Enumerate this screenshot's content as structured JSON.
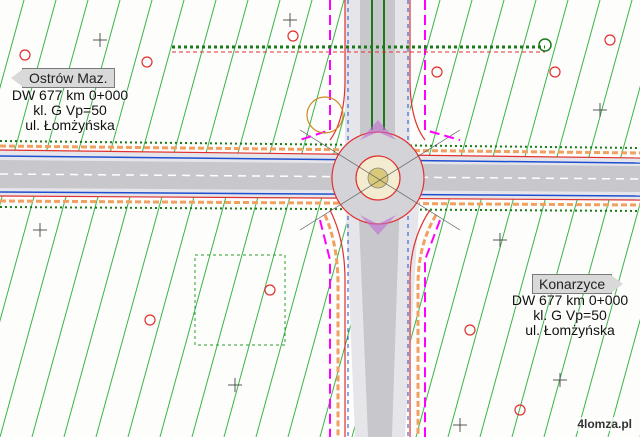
{
  "watermark": "4lomza.pl",
  "west": {
    "direction": "Ostrów Maz.",
    "road": "DW 677 km 0+000",
    "class": "kl. G Vp=50",
    "street": "ul. Łomżyńska"
  },
  "east": {
    "direction": "Konarzyce",
    "road": "DW 677 km 0+000",
    "class": "kl. G Vp=50",
    "street": "ul. Łomżyńska"
  },
  "colors": {
    "parcel_lines": "#39b54a",
    "road_surface": "#c8c8cc",
    "boundary": "#ff00ff",
    "curb": "#e03030",
    "sidewalk": "#f0a060",
    "drainage": "#1f4fd0"
  }
}
